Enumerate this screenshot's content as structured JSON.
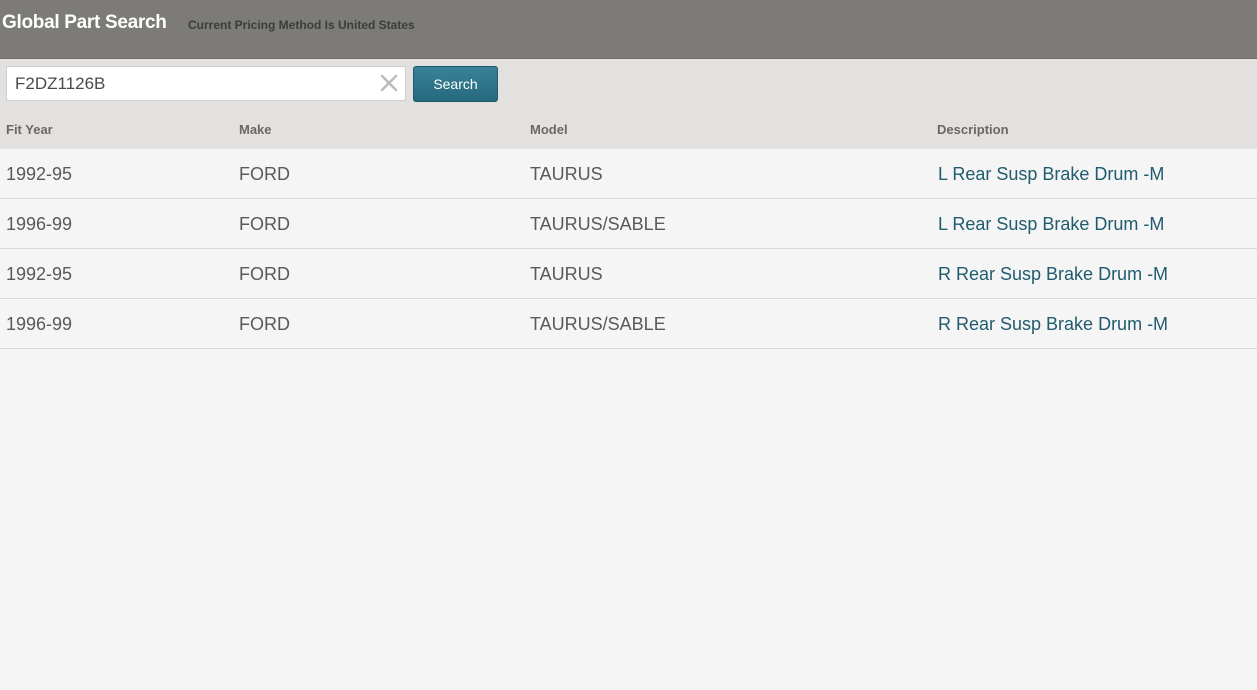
{
  "header": {
    "title": "Global Part Search",
    "pricing_note": "Current Pricing Method Is United States"
  },
  "search": {
    "value": "F2DZ1126B",
    "button_label": "Search",
    "clear_icon": "close-x-icon"
  },
  "table": {
    "columns": [
      "Fit Year",
      "Make",
      "Model",
      "Description"
    ],
    "rows": [
      {
        "year": "1992-95",
        "make": "FORD",
        "model": "TAURUS",
        "description": "L Rear Susp Brake Drum -M"
      },
      {
        "year": "1996-99",
        "make": "FORD",
        "model": "TAURUS/SABLE",
        "description": "L Rear Susp Brake Drum -M"
      },
      {
        "year": "1992-95",
        "make": "FORD",
        "model": "TAURUS",
        "description": "R Rear Susp Brake Drum -M"
      },
      {
        "year": "1996-99",
        "make": "FORD",
        "model": "TAURUS/SABLE",
        "description": "R Rear Susp Brake Drum -M"
      }
    ]
  },
  "colors": {
    "header_bg": "#7c7b77",
    "button_bg": "#2e7489",
    "link_text": "#215b6e"
  }
}
